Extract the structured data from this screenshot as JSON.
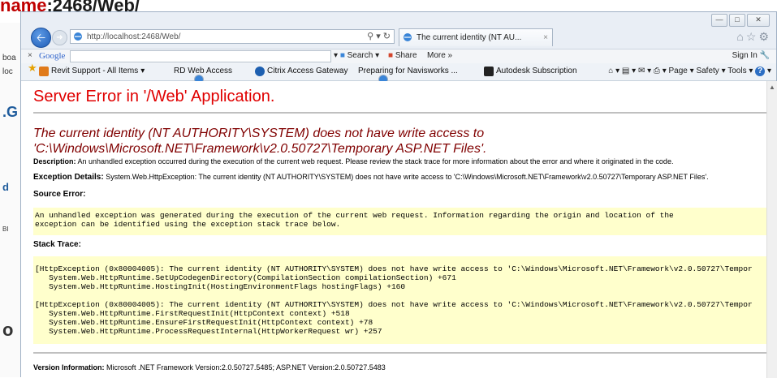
{
  "background": {
    "title_red": "name",
    "title_rest": ":2468/Web/",
    "sidebar_fragments": [
      "boa",
      "loc",
      ".G",
      "d",
      "BI",
      "o"
    ]
  },
  "window": {
    "controls": [
      "minimize",
      "maximize",
      "close"
    ]
  },
  "nav": {
    "address_url": "http://localhost:2468/Web/",
    "tab_title": "The current identity (NT AU...",
    "tab_close": "×"
  },
  "google_bar": {
    "close": "×",
    "logo": "Google",
    "search_label": "Search",
    "share_label": "Share",
    "more_label": "More »",
    "sign_in": "Sign In"
  },
  "favorites": {
    "items": [
      "Revit Support - All Items",
      "RD Web Access",
      "Citrix Access Gateway",
      "Preparing for Navisworks ...",
      "Autodesk Subscription"
    ],
    "commands": [
      "Page",
      "Safety",
      "Tools"
    ]
  },
  "error_page": {
    "title": "Server Error in '/Web' Application.",
    "message_line1": "The current identity (NT AUTHORITY\\SYSTEM) does not have write access to",
    "message_line2": "'C:\\Windows\\Microsoft.NET\\Framework\\v2.0.50727\\Temporary ASP.NET Files'.",
    "description_label": "Description:",
    "description_text": " An unhandled exception occurred during the execution of the current web request. Please review the stack trace for more information about the error and where it originated in the code.",
    "exception_label": "Exception Details:",
    "exception_text": " System.Web.HttpException: The current identity (NT AUTHORITY\\SYSTEM) does not have write access to 'C:\\Windows\\Microsoft.NET\\Framework\\v2.0.50727\\Temporary ASP.NET Files'.",
    "source_error_label": "Source Error:",
    "source_error_text": "An unhandled exception was generated during the execution of the current web request. Information regarding the origin and location of the\nexception can be identified using the exception stack trace below.",
    "stack_trace_label": "Stack Trace:",
    "stack_trace_text": "[HttpException (0x80004005): The current identity (NT AUTHORITY\\SYSTEM) does not have write access to 'C:\\Windows\\Microsoft.NET\\Framework\\v2.0.50727\\Tempor\n   System.Web.HttpRuntime.SetUpCodegenDirectory(CompilationSection compilationSection) +671\n   System.Web.HttpRuntime.HostingInit(HostingEnvironmentFlags hostingFlags) +160\n\n[HttpException (0x80004005): The current identity (NT AUTHORITY\\SYSTEM) does not have write access to 'C:\\Windows\\Microsoft.NET\\Framework\\v2.0.50727\\Tempor\n   System.Web.HttpRuntime.FirstRequestInit(HttpContext context) +518\n   System.Web.HttpRuntime.EnsureFirstRequestInit(HttpContext context) +78\n   System.Web.HttpRuntime.ProcessRequestInternal(HttpWorkerRequest wr) +257",
    "version_label": "Version Information:",
    "version_text": " Microsoft .NET Framework Version:2.0.50727.5485; ASP.NET Version:2.0.50727.5483"
  },
  "colors": {
    "error_title": "#e00000",
    "error_message": "#800000",
    "code_background": "#ffffcc"
  }
}
